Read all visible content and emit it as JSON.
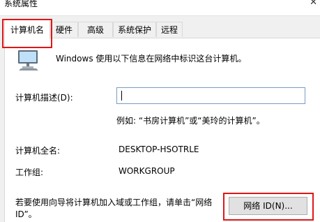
{
  "window": {
    "title": "系统属性"
  },
  "tabs": [
    "计算机名",
    "硬件",
    "高级",
    "系统保护",
    "远程"
  ],
  "intro": "Windows 使用以下信息在网络中标识这台计算机。",
  "desc_label": "计算机描述(D):",
  "desc_value": "",
  "desc_example": "例如: “书房计算机”或“美玲的计算机”。",
  "fullname_label": "计算机全名:",
  "fullname_value": "DESKTOP-HSOTRLE",
  "workgroup_label": "工作组:",
  "workgroup_value": "WORKGROUP",
  "wizard_text": "若要使用向导将计算机加入域或工作组，请单击“网络 ID”。",
  "network_id_button": "网络 ID(N)...",
  "colors": {
    "highlight": "#e01616",
    "input_border": "#7a9cc2"
  },
  "icons": {
    "computer": "computer-icon",
    "close": "close-icon"
  }
}
